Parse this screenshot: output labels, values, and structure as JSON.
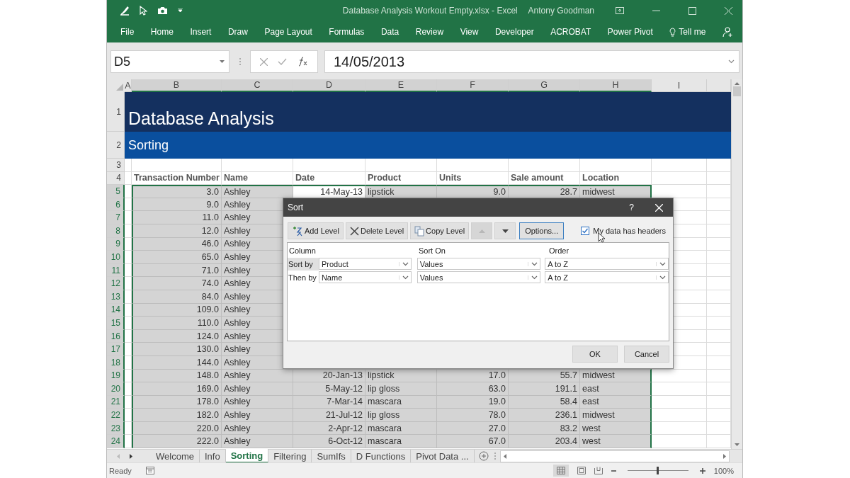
{
  "title_bar": {
    "title": "Database Analysis Workout Empty.xlsx  -  Excel",
    "user": "Antony Goodman"
  },
  "ribbon_tabs": [
    "File",
    "Home",
    "Insert",
    "Draw",
    "Page Layout",
    "Formulas",
    "Data",
    "Review",
    "View",
    "Developer",
    "ACROBAT",
    "Power Pivot"
  ],
  "tell_me": "Tell me",
  "formula_bar": {
    "name_box": "D5",
    "value": "14/05/2013"
  },
  "sheet": {
    "column_headers": [
      {
        "label": "A",
        "highlighted": false
      },
      {
        "label": "B",
        "highlighted": true
      },
      {
        "label": "C",
        "highlighted": true
      },
      {
        "label": "D",
        "highlighted": true
      },
      {
        "label": "E",
        "highlighted": true
      },
      {
        "label": "F",
        "highlighted": true
      },
      {
        "label": "G",
        "highlighted": true
      },
      {
        "label": "H",
        "highlighted": true
      },
      {
        "label": "I",
        "highlighted": false
      }
    ],
    "banner": {
      "row": "1",
      "title": "Database Analysis"
    },
    "subtitle": {
      "row": "2",
      "text": "Sorting"
    },
    "blank_row": "3",
    "header_row": {
      "row": "4",
      "labels": [
        "Transaction Number",
        "Name",
        "Date",
        "Product",
        "Units",
        "Sale amount",
        "Location"
      ]
    },
    "rows": [
      {
        "number": "5",
        "highlighted": true,
        "cells": [
          {
            "text": "3.0",
            "active": false
          },
          {
            "text": "Ashley",
            "active": false
          },
          {
            "text": "14-May-13",
            "active": true
          },
          {
            "text": "lipstick",
            "active": false
          },
          {
            "text": "9.0",
            "active": false
          },
          {
            "text": "28.7",
            "active": false
          },
          {
            "text": "midwest",
            "active": false
          }
        ]
      },
      {
        "number": "6",
        "highlighted": true,
        "cells": [
          {
            "text": "9.0",
            "active": false
          },
          {
            "text": "Ashley",
            "active": false
          }
        ]
      },
      {
        "number": "7",
        "highlighted": true,
        "cells": [
          {
            "text": "11.0",
            "active": false
          },
          {
            "text": "Ashley",
            "active": false
          }
        ]
      },
      {
        "number": "8",
        "highlighted": true,
        "cells": [
          {
            "text": "12.0",
            "active": false
          },
          {
            "text": "Ashley",
            "active": false
          }
        ]
      },
      {
        "number": "9",
        "highlighted": true,
        "cells": [
          {
            "text": "46.0",
            "active": false
          },
          {
            "text": "Ashley",
            "active": false
          }
        ]
      },
      {
        "number": "10",
        "highlighted": true,
        "cells": [
          {
            "text": "65.0",
            "active": false
          },
          {
            "text": "Ashley",
            "active": false
          }
        ]
      },
      {
        "number": "11",
        "highlighted": true,
        "cells": [
          {
            "text": "71.0",
            "active": false
          },
          {
            "text": "Ashley",
            "active": false
          }
        ]
      },
      {
        "number": "12",
        "highlighted": true,
        "cells": [
          {
            "text": "74.0",
            "active": false
          },
          {
            "text": "Ashley",
            "active": false
          }
        ]
      },
      {
        "number": "13",
        "highlighted": true,
        "cells": [
          {
            "text": "84.0",
            "active": false
          },
          {
            "text": "Ashley",
            "active": false
          }
        ]
      },
      {
        "number": "14",
        "highlighted": true,
        "cells": [
          {
            "text": "109.0",
            "active": false
          },
          {
            "text": "Ashley",
            "active": false
          }
        ]
      },
      {
        "number": "15",
        "highlighted": true,
        "cells": [
          {
            "text": "110.0",
            "active": false
          },
          {
            "text": "Ashley",
            "active": false
          }
        ]
      },
      {
        "number": "16",
        "highlighted": true,
        "cells": [
          {
            "text": "124.0",
            "active": false
          },
          {
            "text": "Ashley",
            "active": false
          }
        ]
      },
      {
        "number": "17",
        "highlighted": true,
        "cells": [
          {
            "text": "130.0",
            "active": false
          },
          {
            "text": "Ashley",
            "active": false
          }
        ]
      },
      {
        "number": "18",
        "highlighted": true,
        "cells": [
          {
            "text": "144.0",
            "active": false
          },
          {
            "text": "Ashley",
            "active": false
          }
        ]
      },
      {
        "number": "19",
        "highlighted": true,
        "cells": [
          {
            "text": "148.0",
            "active": false
          },
          {
            "text": "Ashley",
            "active": false
          },
          {
            "text": "20-Jan-13",
            "active": false
          },
          {
            "text": "lipstick",
            "active": false
          },
          {
            "text": "17.0",
            "active": false
          },
          {
            "text": "55.7",
            "active": false
          },
          {
            "text": "midwest",
            "active": false
          }
        ]
      },
      {
        "number": "20",
        "highlighted": true,
        "cells": [
          {
            "text": "169.0",
            "active": false
          },
          {
            "text": "Ashley",
            "active": false
          },
          {
            "text": "5-May-12",
            "active": false
          },
          {
            "text": "lip gloss",
            "active": false
          },
          {
            "text": "63.0",
            "active": false
          },
          {
            "text": "191.1",
            "active": false
          },
          {
            "text": "east",
            "active": false
          }
        ]
      },
      {
        "number": "21",
        "highlighted": true,
        "cells": [
          {
            "text": "178.0",
            "active": false
          },
          {
            "text": "Ashley",
            "active": false
          },
          {
            "text": "7-Mar-14",
            "active": false
          },
          {
            "text": "mascara",
            "active": false
          },
          {
            "text": "19.0",
            "active": false
          },
          {
            "text": "58.4",
            "active": false
          },
          {
            "text": "east",
            "active": false
          }
        ]
      },
      {
        "number": "22",
        "highlighted": true,
        "cells": [
          {
            "text": "182.0",
            "active": false
          },
          {
            "text": "Ashley",
            "active": false
          },
          {
            "text": "21-Jul-12",
            "active": false
          },
          {
            "text": "lip gloss",
            "active": false
          },
          {
            "text": "78.0",
            "active": false
          },
          {
            "text": "236.1",
            "active": false
          },
          {
            "text": "midwest",
            "active": false
          }
        ]
      },
      {
        "number": "23",
        "highlighted": true,
        "cells": [
          {
            "text": "220.0",
            "active": false
          },
          {
            "text": "Ashley",
            "active": false
          },
          {
            "text": "2-Apr-12",
            "active": false
          },
          {
            "text": "mascara",
            "active": false
          },
          {
            "text": "27.0",
            "active": false
          },
          {
            "text": "83.2",
            "active": false
          },
          {
            "text": "west",
            "active": false
          }
        ]
      },
      {
        "number": "24",
        "highlighted": true,
        "cells": [
          {
            "text": "222.0",
            "active": false
          },
          {
            "text": "Ashley",
            "active": false
          },
          {
            "text": "6-Oct-12",
            "active": false
          },
          {
            "text": "mascara",
            "active": false
          },
          {
            "text": "67.0",
            "active": false
          },
          {
            "text": "203.4",
            "active": false
          },
          {
            "text": "west",
            "active": false
          }
        ]
      }
    ]
  },
  "sort_dialog": {
    "title": "Sort",
    "help": "?",
    "toolbar": [
      {
        "kind": "add",
        "label": "Add Level"
      },
      {
        "kind": "delete",
        "label": "Delete Level"
      },
      {
        "kind": "copy",
        "label": "Copy Level"
      },
      {
        "kind": "move",
        "buttons": [
          {
            "kind": "up",
            "disabled": true
          },
          {
            "kind": "down",
            "disabled": false
          }
        ]
      },
      {
        "kind": "options",
        "label": "Options..."
      }
    ],
    "headers_checkbox": {
      "label": "My data has headers",
      "checked": true
    },
    "columns": [
      "Column",
      "Sort On",
      "Order"
    ],
    "levels": [
      {
        "label": "Sort by",
        "column": "Product",
        "sort_on": "Values",
        "order": "A to Z",
        "selected": true
      },
      {
        "label": "Then by",
        "column": "Name",
        "sort_on": "Values",
        "order": "A to Z",
        "selected": false
      }
    ],
    "buttons": [
      "OK",
      "Cancel"
    ]
  },
  "sheet_tabs": [
    {
      "label": "Welcome",
      "selected": false
    },
    {
      "label": "Info",
      "selected": false
    },
    {
      "label": "Sorting",
      "selected": true
    },
    {
      "label": "Filtering",
      "selected": false
    },
    {
      "label": "SumIfs",
      "selected": false
    },
    {
      "label": "D Functions",
      "selected": false
    },
    {
      "label": "Pivot Data ...",
      "selected": false
    }
  ],
  "status_bar": {
    "status": "Ready",
    "zoom": {
      "level": 0.49,
      "reading": "100%"
    }
  }
}
